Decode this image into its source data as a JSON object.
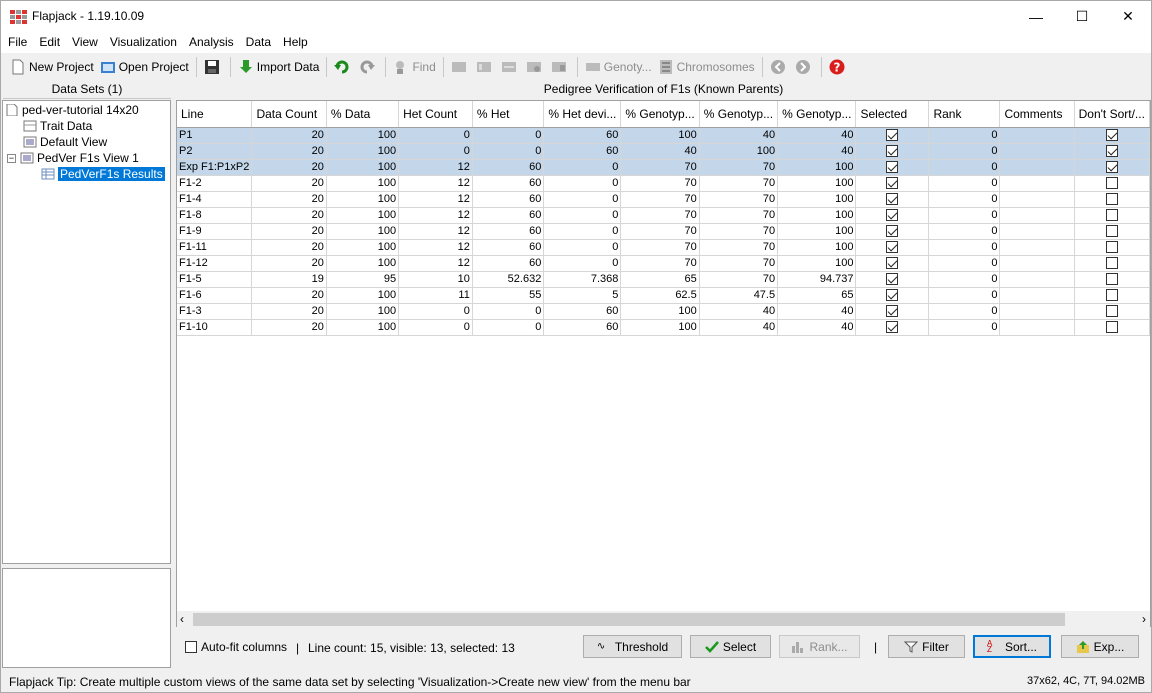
{
  "window": {
    "title": "Flapjack - 1.19.10.09",
    "min": "—",
    "max": "☐",
    "close": "✕"
  },
  "menu": [
    "File",
    "Edit",
    "View",
    "Visualization",
    "Analysis",
    "Data",
    "Help"
  ],
  "toolbar": {
    "new_project": "New Project",
    "open_project": "Open Project",
    "import_data": "Import Data",
    "find": "Find",
    "genotypes": "Genoty...",
    "chromosomes": "Chromosomes"
  },
  "left": {
    "header": "Data Sets (1)",
    "tree": {
      "root": "ped-ver-tutorial  14x20",
      "trait": "Trait Data",
      "default_view": "Default View",
      "pedver_view": "PedVer F1s View 1",
      "results": "PedVerF1s Results"
    }
  },
  "right": {
    "header": "Pedigree Verification of F1s (Known Parents)",
    "columns": [
      "Line",
      "Data Count",
      "% Data",
      "Het Count",
      "% Het",
      "% Het devi...",
      "% Genotyp...",
      "% Genotyp...",
      "% Genotyp...",
      "Selected",
      "Rank",
      "Comments",
      "Don't Sort/..."
    ],
    "rows": [
      {
        "c": [
          "P1",
          "20",
          "100",
          "0",
          "0",
          "60",
          "100",
          "40",
          "40",
          "",
          "0",
          ""
        ],
        "selected": true,
        "dontsort": true,
        "highlight": true
      },
      {
        "c": [
          "P2",
          "20",
          "100",
          "0",
          "0",
          "60",
          "40",
          "100",
          "40",
          "",
          "0",
          ""
        ],
        "selected": true,
        "dontsort": true,
        "highlight": true
      },
      {
        "c": [
          "Exp F1:P1xP2",
          "20",
          "100",
          "12",
          "60",
          "0",
          "70",
          "70",
          "100",
          "",
          "0",
          ""
        ],
        "selected": true,
        "dontsort": true,
        "highlight": true
      },
      {
        "c": [
          "F1-2",
          "20",
          "100",
          "12",
          "60",
          "0",
          "70",
          "70",
          "100",
          "",
          "0",
          ""
        ],
        "selected": true,
        "dontsort": false,
        "highlight": false
      },
      {
        "c": [
          "F1-4",
          "20",
          "100",
          "12",
          "60",
          "0",
          "70",
          "70",
          "100",
          "",
          "0",
          ""
        ],
        "selected": true,
        "dontsort": false,
        "highlight": false
      },
      {
        "c": [
          "F1-8",
          "20",
          "100",
          "12",
          "60",
          "0",
          "70",
          "70",
          "100",
          "",
          "0",
          ""
        ],
        "selected": true,
        "dontsort": false,
        "highlight": false
      },
      {
        "c": [
          "F1-9",
          "20",
          "100",
          "12",
          "60",
          "0",
          "70",
          "70",
          "100",
          "",
          "0",
          ""
        ],
        "selected": true,
        "dontsort": false,
        "highlight": false
      },
      {
        "c": [
          "F1-11",
          "20",
          "100",
          "12",
          "60",
          "0",
          "70",
          "70",
          "100",
          "",
          "0",
          ""
        ],
        "selected": true,
        "dontsort": false,
        "highlight": false
      },
      {
        "c": [
          "F1-12",
          "20",
          "100",
          "12",
          "60",
          "0",
          "70",
          "70",
          "100",
          "",
          "0",
          ""
        ],
        "selected": true,
        "dontsort": false,
        "highlight": false
      },
      {
        "c": [
          "F1-5",
          "19",
          "95",
          "10",
          "52.632",
          "7.368",
          "65",
          "70",
          "94.737",
          "",
          "0",
          ""
        ],
        "selected": true,
        "dontsort": false,
        "highlight": false
      },
      {
        "c": [
          "F1-6",
          "20",
          "100",
          "11",
          "55",
          "5",
          "62.5",
          "47.5",
          "65",
          "",
          "0",
          ""
        ],
        "selected": true,
        "dontsort": false,
        "highlight": false
      },
      {
        "c": [
          "F1-3",
          "20",
          "100",
          "0",
          "0",
          "60",
          "100",
          "40",
          "40",
          "",
          "0",
          ""
        ],
        "selected": true,
        "dontsort": false,
        "highlight": false
      },
      {
        "c": [
          "F1-10",
          "20",
          "100",
          "0",
          "0",
          "60",
          "100",
          "40",
          "40",
          "",
          "0",
          ""
        ],
        "selected": true,
        "dontsort": false,
        "highlight": false
      }
    ]
  },
  "bottom": {
    "autofit": "Auto-fit columns",
    "separator": "|",
    "status": "Line count: 15, visible: 13, selected: 13",
    "threshold": "Threshold",
    "select": "Select",
    "rank": "Rank...",
    "filter": "Filter",
    "sort": "Sort...",
    "export": "Exp..."
  },
  "tip": "Flapjack Tip:  Create multiple custom views of the same data set by selecting 'Visualization->Create new view' from the menu bar",
  "memory": "37x62, 4C, 7T, 94.02MB"
}
